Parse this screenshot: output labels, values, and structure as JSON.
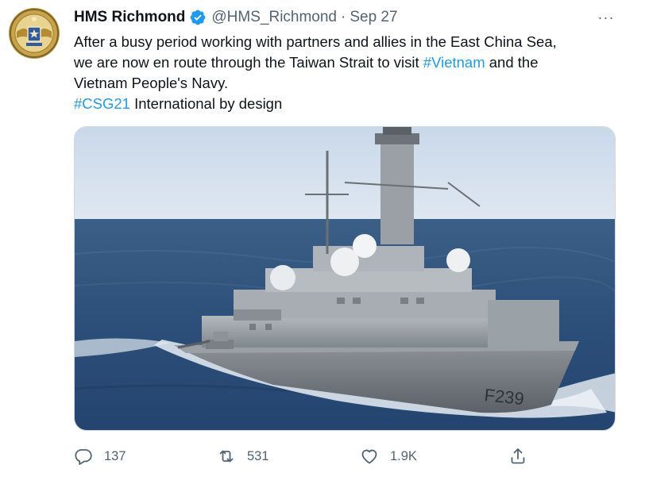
{
  "tweet": {
    "author_name": "HMS Richmond",
    "handle": "@HMS_Richmond",
    "separator": "·",
    "time": "Sep 27",
    "more_label": "···",
    "text_line1": "After a busy period working with partners and allies in the East China Sea,",
    "text_line2_a": "we are now en route through the Taiwan Strait to visit ",
    "text_line2_tag": "#Vietnam",
    "text_line2_b": " and the",
    "text_line3": "Vietnam People's Navy.",
    "text_line4_tag": "#CSG21",
    "text_line4_b": " International by design",
    "media": {
      "hull_number": "F239"
    }
  },
  "actions": {
    "reply_count": "137",
    "retweet_count": "531",
    "like_count": "1.9K"
  },
  "icons": {
    "verified": "verified-badge-icon",
    "reply": "reply-icon",
    "retweet": "retweet-icon",
    "like": "heart-icon",
    "share": "share-icon",
    "more": "more-icon"
  },
  "colors": {
    "link": "#1d9bf0",
    "secondary_text": "#536471",
    "primary_text": "#0f1419",
    "verified": "#1d9bf0"
  }
}
